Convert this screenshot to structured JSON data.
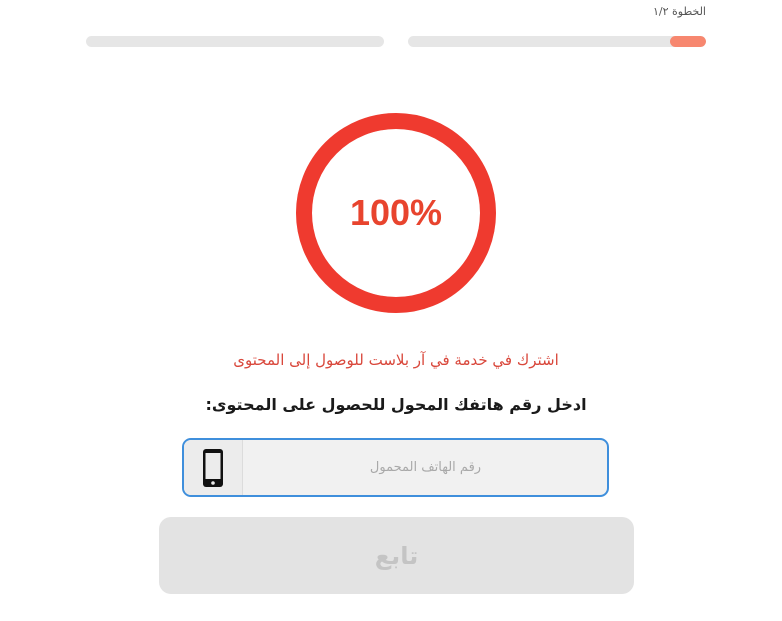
{
  "header": {
    "step_label": "الخطوة ١/٢",
    "step1_progress": 0.12,
    "step2_progress": 0
  },
  "progress_ring": {
    "value_text": "100%",
    "value": 1.0,
    "color": "#ef3a2f"
  },
  "content": {
    "subscribe_text": "اشترك في خدمة في آر بلاست للوصول إلى المحتوى",
    "enter_phone_text": "ادخل رقم هاتفك المحول للحصول على المحتوى:"
  },
  "phone_field": {
    "icon": "mobile-phone-icon",
    "placeholder": "رقم الهاتف المحمول",
    "value": ""
  },
  "continue_button": {
    "label": "تابع"
  },
  "colors": {
    "accent": "#ef3a2f",
    "progress_fill": "#f7876f",
    "input_border": "#3f8fdc"
  }
}
